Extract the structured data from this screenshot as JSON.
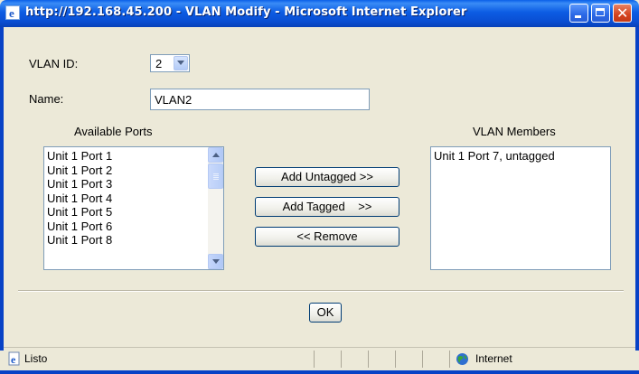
{
  "window": {
    "title": "http://192.168.45.200 - VLAN Modify - Microsoft Internet Explorer"
  },
  "form": {
    "vlan_id_label": "VLAN ID:",
    "vlan_id_value": "2",
    "name_label": "Name:",
    "name_value": "VLAN2",
    "available_ports_label": "Available Ports",
    "available_ports": [
      "Unit 1 Port 1",
      "Unit 1 Port 2",
      "Unit 1 Port 3",
      "Unit 1 Port 4",
      "Unit 1 Port 5",
      "Unit 1 Port 6",
      "Unit 1 Port 8"
    ],
    "vlan_members_label": "VLAN Members",
    "vlan_members": [
      "Unit 1 Port 7, untagged"
    ],
    "add_untagged_label": "Add Untagged >>",
    "add_tagged_label": "Add Tagged    >>",
    "remove_label": "<< Remove",
    "ok_label": "OK"
  },
  "statusbar": {
    "status_text": "Listo",
    "zone_text": "Internet"
  },
  "icons": {
    "app": "ie-page-icon",
    "status": "ie-page-icon",
    "zone": "globe-icon"
  },
  "colors": {
    "titlebar": "#0a4ed2",
    "frame": "#0842c6",
    "face": "#ece9d8",
    "close_button": "#d4431e"
  }
}
